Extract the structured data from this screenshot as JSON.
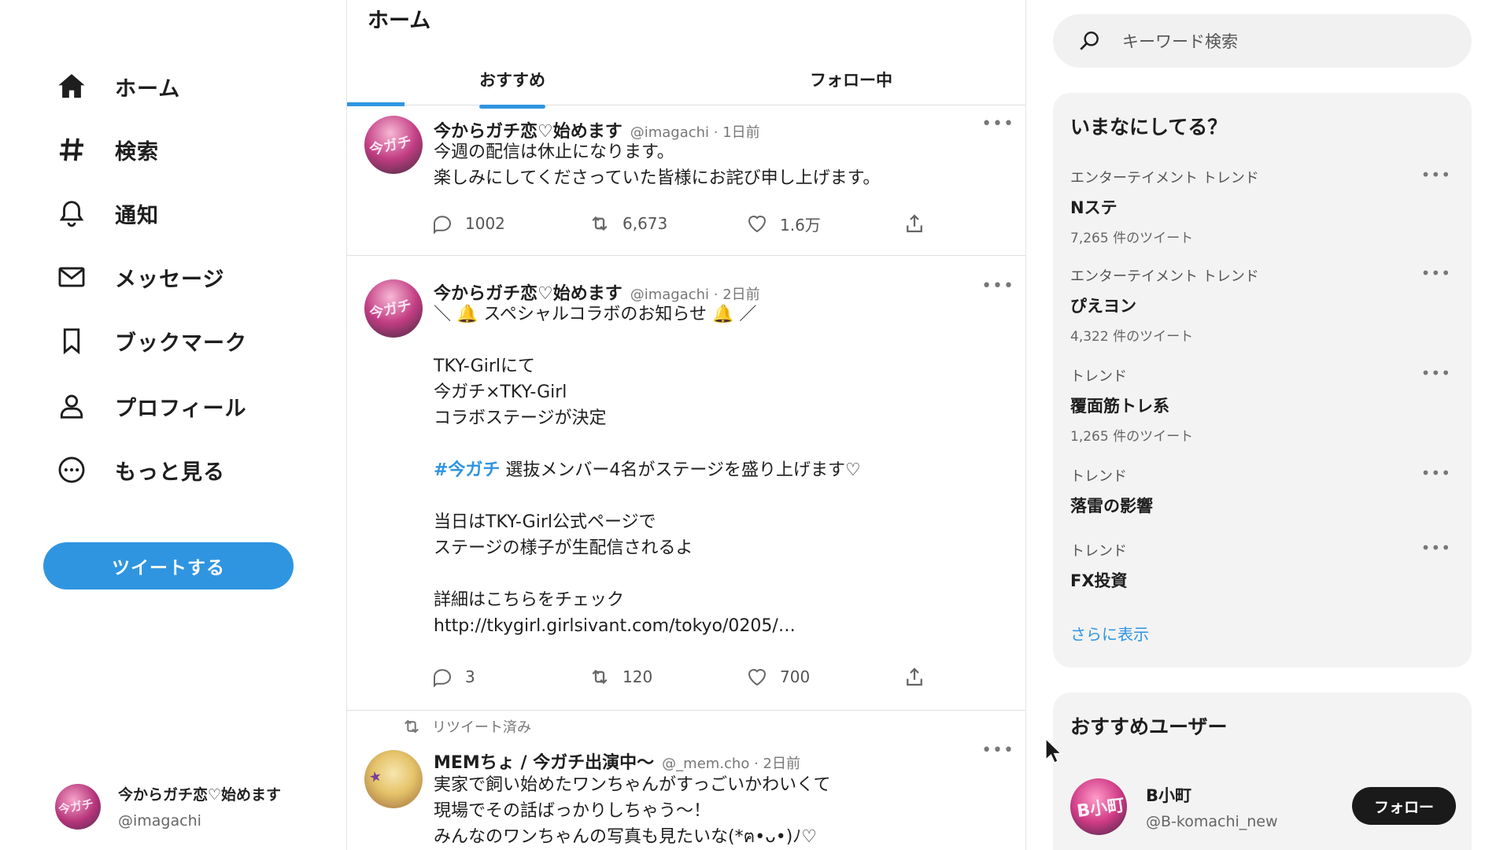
{
  "nav": {
    "items": [
      {
        "label": "ホーム",
        "icon": "home-icon"
      },
      {
        "label": "検索",
        "icon": "hash-icon"
      },
      {
        "label": "通知",
        "icon": "bell-icon"
      },
      {
        "label": "メッセージ",
        "icon": "mail-icon"
      },
      {
        "label": "ブックマーク",
        "icon": "bookmark-icon"
      },
      {
        "label": "プロフィール",
        "icon": "profile-icon"
      },
      {
        "label": "もっと見る",
        "icon": "more-circle-icon"
      }
    ],
    "tweet_button": "ツイートする",
    "account": {
      "name": "今からガチ恋♡始めます",
      "handle": "@imagachi"
    }
  },
  "main": {
    "title": "ホーム",
    "tabs": [
      "おすすめ",
      "フォロー中"
    ],
    "tweets": [
      {
        "name": "今からガチ恋♡始めます",
        "meta": "@imagachi · 1日前",
        "lines": [
          "今週の配信は休止になります。",
          "楽しみにしてくださっていた皆様にお詫び申し上げます。"
        ],
        "replies": "1002",
        "retweets": "6,673",
        "likes": "1.6万"
      },
      {
        "name": "今からガチ恋♡始めます",
        "meta": "@imagachi · 2日前",
        "lines": [
          "＼ 🔔 スペシャルコラボのお知らせ 🔔 ／",
          "",
          "TKY-Girlにて",
          "今ガチ×TKY-Girl",
          "コラボステージが決定",
          "",
          "",
          "",
          "当日はTKY-Girl公式ページで",
          "ステージの様子が生配信されるよ",
          "",
          "詳細はこちらをチェック",
          "http://tkygirl.girlsivant.com/tokyo/0205/…"
        ],
        "hashtag": "#今ガチ",
        "hashtag_rest": " 選抜メンバー4名がステージを盛り上げます♡",
        "replies": "3",
        "retweets": "120",
        "likes": "700"
      },
      {
        "retweet_label": "リツイート済み",
        "name": "MEMちょ / 今ガチ出演中～",
        "meta": "@_mem.cho · 2日前",
        "lines": [
          "実家で飼い始めたワンちゃんがすっごいかわいくて",
          "現場でその話ばっかりしちゃう～！",
          "みんなのワンちゃんの写真も見たいな(*ฅ•ᴗ•)ﾉ♡"
        ]
      }
    ]
  },
  "sidebar": {
    "search_placeholder": "キーワード検索",
    "trends_title": "いまなにしてる？",
    "trends": [
      {
        "category": "エンターテイメント トレンド",
        "title": "Nステ",
        "count": "7,265 件のツイート"
      },
      {
        "category": "エンターテイメント トレンド",
        "title": "ぴえヨン",
        "count": "4,322 件のツイート"
      },
      {
        "category": "トレンド",
        "title": "覆面筋トレ系",
        "count": "1,265 件のツイート"
      },
      {
        "category": "トレンド",
        "title": "落雷の影響",
        "count": ""
      },
      {
        "category": "トレンド",
        "title": "FX投資",
        "count": ""
      }
    ],
    "show_more": "さらに表示",
    "recommend_title": "おすすめユーザー",
    "recommend": {
      "name": "B小町",
      "handle": "@B-komachi_new",
      "follow": "フォロー"
    }
  },
  "avatar_marks": {
    "imagachi": "今ガチ",
    "bkomachi": "B小町"
  },
  "colors": {
    "accent": "#2f95e0",
    "follow_button": "#1a1a1a",
    "panel": "#f3f3f3"
  }
}
